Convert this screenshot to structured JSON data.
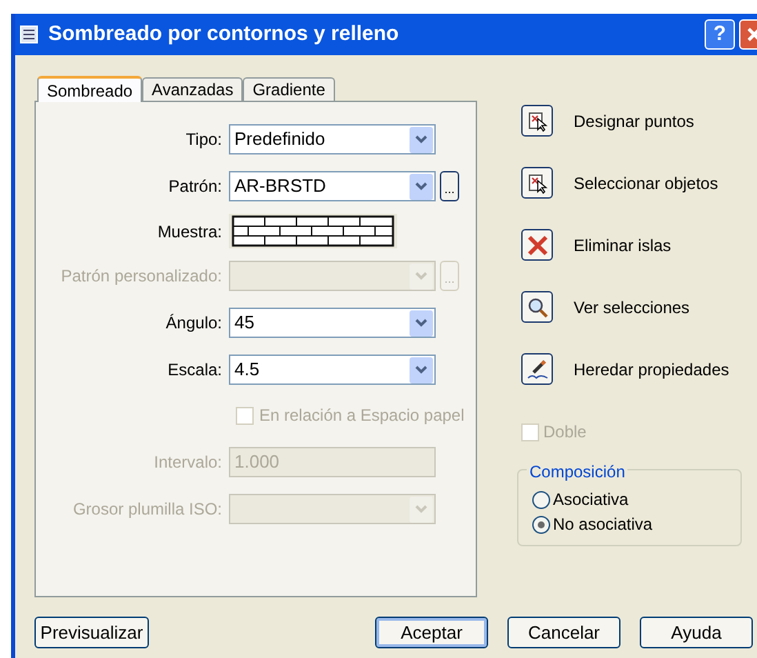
{
  "window": {
    "title": "Sombreado por contornos y relleno",
    "help_button": "?"
  },
  "tabs": [
    {
      "label": "Sombreado",
      "selected": true
    },
    {
      "label": "Avanzadas",
      "selected": false
    },
    {
      "label": "Gradiente",
      "selected": false
    }
  ],
  "fields": [
    {
      "kind": "combo",
      "label": "Tipo:",
      "value": "Predefinido",
      "disabled": false
    },
    {
      "kind": "combo",
      "label": "Patrón:",
      "value": "AR-BRSTD",
      "disabled": false,
      "browse_label": "..."
    },
    {
      "kind": "sample",
      "label": "Muestra:",
      "disabled": false
    },
    {
      "kind": "combo",
      "label": "Patrón personalizado:",
      "disabled": true,
      "browse_label": "..."
    },
    {
      "kind": "combo",
      "label": "Ángulo:",
      "value": "45",
      "disabled": false
    },
    {
      "kind": "combo",
      "label": "Escala:",
      "value": "4.5",
      "disabled": false
    },
    {
      "kind": "checkbox",
      "label": "En relación a Espacio papel",
      "checked": false,
      "disabled": true
    },
    {
      "kind": "text",
      "label": "Intervalo:",
      "value": "1.000",
      "disabled": true
    },
    {
      "kind": "combo",
      "label": "Grosor plumilla ISO:",
      "disabled": true
    }
  ],
  "actions": [
    {
      "kind": "pick",
      "label": "Designar puntos"
    },
    {
      "kind": "select",
      "label": "Seleccionar objetos"
    },
    {
      "kind": "remove",
      "label": "Eliminar islas"
    },
    {
      "kind": "view",
      "label": "Ver selecciones"
    },
    {
      "kind": "inherit",
      "label": "Heredar propiedades"
    }
  ],
  "double": {
    "label": "Doble",
    "checked": false,
    "disabled": true
  },
  "composition": {
    "title": "Composición",
    "options": [
      {
        "label": "Asociativa",
        "selected": false
      },
      {
        "label": "No asociativa",
        "selected": true
      }
    ]
  },
  "buttons": [
    {
      "label": "Previsualizar",
      "default": false
    },
    {
      "label": "Aceptar",
      "default": true
    },
    {
      "label": "Cancelar",
      "default": false
    },
    {
      "label": "Ayuda",
      "default": false
    }
  ]
}
